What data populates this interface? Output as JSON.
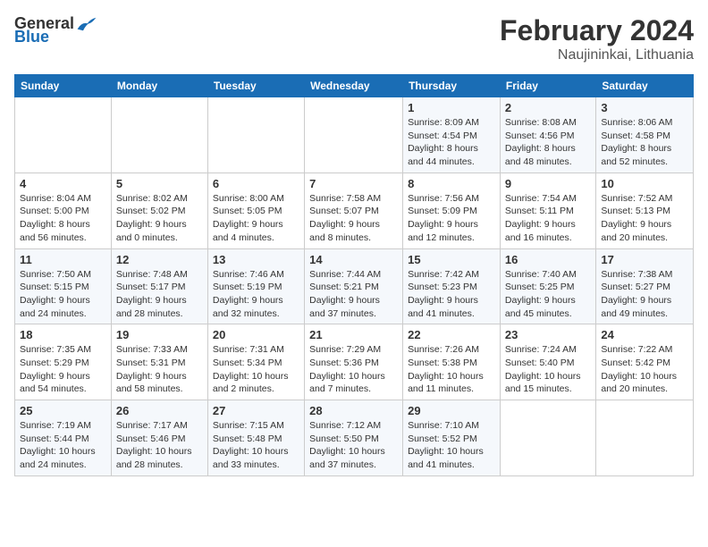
{
  "logo": {
    "general": "General",
    "blue": "Blue"
  },
  "title": "February 2024",
  "subtitle": "Naujininkai, Lithuania",
  "days_of_week": [
    "Sunday",
    "Monday",
    "Tuesday",
    "Wednesday",
    "Thursday",
    "Friday",
    "Saturday"
  ],
  "weeks": [
    [
      {
        "day": "",
        "info": ""
      },
      {
        "day": "",
        "info": ""
      },
      {
        "day": "",
        "info": ""
      },
      {
        "day": "",
        "info": ""
      },
      {
        "day": "1",
        "info": "Sunrise: 8:09 AM\nSunset: 4:54 PM\nDaylight: 8 hours and 44 minutes."
      },
      {
        "day": "2",
        "info": "Sunrise: 8:08 AM\nSunset: 4:56 PM\nDaylight: 8 hours and 48 minutes."
      },
      {
        "day": "3",
        "info": "Sunrise: 8:06 AM\nSunset: 4:58 PM\nDaylight: 8 hours and 52 minutes."
      }
    ],
    [
      {
        "day": "4",
        "info": "Sunrise: 8:04 AM\nSunset: 5:00 PM\nDaylight: 8 hours and 56 minutes."
      },
      {
        "day": "5",
        "info": "Sunrise: 8:02 AM\nSunset: 5:02 PM\nDaylight: 9 hours and 0 minutes."
      },
      {
        "day": "6",
        "info": "Sunrise: 8:00 AM\nSunset: 5:05 PM\nDaylight: 9 hours and 4 minutes."
      },
      {
        "day": "7",
        "info": "Sunrise: 7:58 AM\nSunset: 5:07 PM\nDaylight: 9 hours and 8 minutes."
      },
      {
        "day": "8",
        "info": "Sunrise: 7:56 AM\nSunset: 5:09 PM\nDaylight: 9 hours and 12 minutes."
      },
      {
        "day": "9",
        "info": "Sunrise: 7:54 AM\nSunset: 5:11 PM\nDaylight: 9 hours and 16 minutes."
      },
      {
        "day": "10",
        "info": "Sunrise: 7:52 AM\nSunset: 5:13 PM\nDaylight: 9 hours and 20 minutes."
      }
    ],
    [
      {
        "day": "11",
        "info": "Sunrise: 7:50 AM\nSunset: 5:15 PM\nDaylight: 9 hours and 24 minutes."
      },
      {
        "day": "12",
        "info": "Sunrise: 7:48 AM\nSunset: 5:17 PM\nDaylight: 9 hours and 28 minutes."
      },
      {
        "day": "13",
        "info": "Sunrise: 7:46 AM\nSunset: 5:19 PM\nDaylight: 9 hours and 32 minutes."
      },
      {
        "day": "14",
        "info": "Sunrise: 7:44 AM\nSunset: 5:21 PM\nDaylight: 9 hours and 37 minutes."
      },
      {
        "day": "15",
        "info": "Sunrise: 7:42 AM\nSunset: 5:23 PM\nDaylight: 9 hours and 41 minutes."
      },
      {
        "day": "16",
        "info": "Sunrise: 7:40 AM\nSunset: 5:25 PM\nDaylight: 9 hours and 45 minutes."
      },
      {
        "day": "17",
        "info": "Sunrise: 7:38 AM\nSunset: 5:27 PM\nDaylight: 9 hours and 49 minutes."
      }
    ],
    [
      {
        "day": "18",
        "info": "Sunrise: 7:35 AM\nSunset: 5:29 PM\nDaylight: 9 hours and 54 minutes."
      },
      {
        "day": "19",
        "info": "Sunrise: 7:33 AM\nSunset: 5:31 PM\nDaylight: 9 hours and 58 minutes."
      },
      {
        "day": "20",
        "info": "Sunrise: 7:31 AM\nSunset: 5:34 PM\nDaylight: 10 hours and 2 minutes."
      },
      {
        "day": "21",
        "info": "Sunrise: 7:29 AM\nSunset: 5:36 PM\nDaylight: 10 hours and 7 minutes."
      },
      {
        "day": "22",
        "info": "Sunrise: 7:26 AM\nSunset: 5:38 PM\nDaylight: 10 hours and 11 minutes."
      },
      {
        "day": "23",
        "info": "Sunrise: 7:24 AM\nSunset: 5:40 PM\nDaylight: 10 hours and 15 minutes."
      },
      {
        "day": "24",
        "info": "Sunrise: 7:22 AM\nSunset: 5:42 PM\nDaylight: 10 hours and 20 minutes."
      }
    ],
    [
      {
        "day": "25",
        "info": "Sunrise: 7:19 AM\nSunset: 5:44 PM\nDaylight: 10 hours and 24 minutes."
      },
      {
        "day": "26",
        "info": "Sunrise: 7:17 AM\nSunset: 5:46 PM\nDaylight: 10 hours and 28 minutes."
      },
      {
        "day": "27",
        "info": "Sunrise: 7:15 AM\nSunset: 5:48 PM\nDaylight: 10 hours and 33 minutes."
      },
      {
        "day": "28",
        "info": "Sunrise: 7:12 AM\nSunset: 5:50 PM\nDaylight: 10 hours and 37 minutes."
      },
      {
        "day": "29",
        "info": "Sunrise: 7:10 AM\nSunset: 5:52 PM\nDaylight: 10 hours and 41 minutes."
      },
      {
        "day": "",
        "info": ""
      },
      {
        "day": "",
        "info": ""
      }
    ]
  ]
}
